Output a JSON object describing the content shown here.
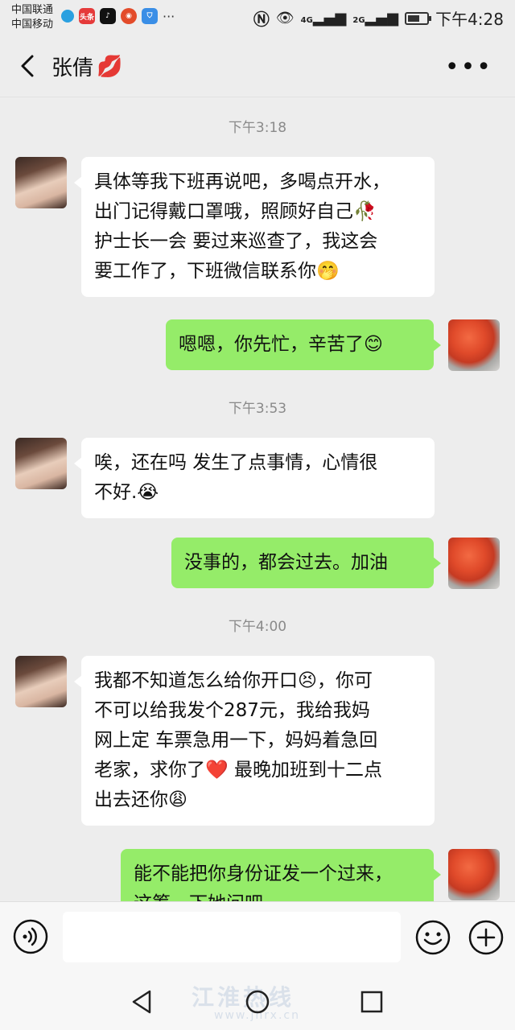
{
  "status_bar": {
    "carrier1": "中国联通",
    "carrier2": "中国移动",
    "apps": [
      "头条"
    ],
    "time": "下午4:28",
    "net1": "4G",
    "net2": "2G"
  },
  "header": {
    "title": "张倩",
    "title_emoji": "💋"
  },
  "messages": [
    {
      "type": "time",
      "text": "下午3:18"
    },
    {
      "type": "in",
      "lines": [
        "具体等我下班再说吧，多喝点开水，",
        "出门记得戴口罩哦，照顾好自己🥀",
        "护士长一会 要过来巡查了，我这会",
        "要工作了，下班微信联系你🤭"
      ]
    },
    {
      "type": "out",
      "lines": [
        "嗯嗯，你先忙，辛苦了😊"
      ]
    },
    {
      "type": "time",
      "text": "下午3:53"
    },
    {
      "type": "in",
      "lines": [
        "唉，还在吗 发生了点事情，心情很",
        "不好.😭"
      ]
    },
    {
      "type": "out",
      "lines": [
        "没事的，都会过去。加油"
      ]
    },
    {
      "type": "time",
      "text": "下午4:00"
    },
    {
      "type": "in",
      "lines": [
        "我都不知道怎么给你开口😣，你可",
        "不可以给我发个287元，我给我妈",
        "网上定 车票急用一下，妈妈着急回",
        "老家，求你了❤️ 最晚加班到十二点",
        "出去还你😩"
      ]
    },
    {
      "type": "out",
      "lines": [
        "能不能把你身份证发一个过来，",
        "这筹一下她问吧"
      ]
    }
  ],
  "input": {
    "placeholder": ""
  },
  "watermark": {
    "text": "江淮热线",
    "url": "www.jhrx.cn"
  },
  "colors": {
    "incoming": "#ffffff",
    "outgoing": "#95ec69",
    "background": "#ededed"
  }
}
